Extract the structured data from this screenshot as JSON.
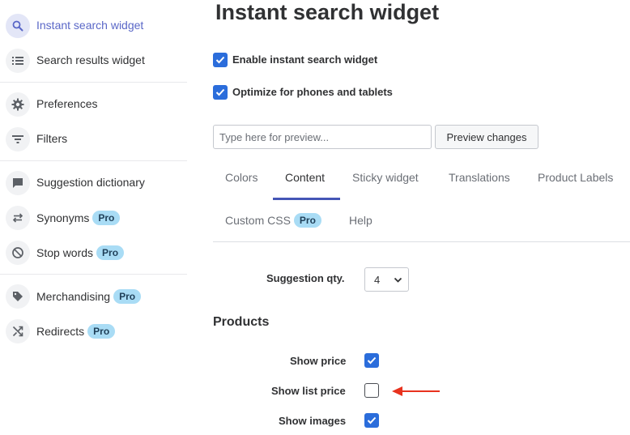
{
  "sidebar": {
    "items": [
      {
        "label": "Instant search widget",
        "icon": "search-icon",
        "active": true
      },
      {
        "label": "Search results widget",
        "icon": "list-icon"
      },
      {
        "label": "Preferences",
        "icon": "gear-icon"
      },
      {
        "label": "Filters",
        "icon": "filter-icon"
      },
      {
        "label": "Suggestion dictionary",
        "icon": "chat-icon"
      },
      {
        "label": "Synonyms",
        "icon": "swap-icon",
        "badge": "Pro"
      },
      {
        "label": "Stop words",
        "icon": "block-icon",
        "badge": "Pro"
      },
      {
        "label": "Merchandising",
        "icon": "tag-icon",
        "badge": "Pro"
      },
      {
        "label": "Redirects",
        "icon": "shuffle-icon",
        "badge": "Pro"
      }
    ]
  },
  "page": {
    "title": "Instant search widget"
  },
  "settings": {
    "enable_label": "Enable instant search widget",
    "enable_checked": true,
    "optimize_label": "Optimize for phones and tablets",
    "optimize_checked": true
  },
  "preview": {
    "placeholder": "Type here for preview...",
    "value": "",
    "button_label": "Preview changes"
  },
  "tabs": [
    {
      "label": "Colors"
    },
    {
      "label": "Content",
      "active": true
    },
    {
      "label": "Sticky widget"
    },
    {
      "label": "Translations"
    },
    {
      "label": "Product Labels"
    },
    {
      "label": "Custom CSS",
      "badge": "Pro"
    },
    {
      "label": "Help"
    }
  ],
  "content": {
    "suggestion_qty_label": "Suggestion qty.",
    "suggestion_qty_value": "4",
    "products_heading": "Products",
    "show_price_label": "Show price",
    "show_price_checked": true,
    "show_list_price_label": "Show list price",
    "show_list_price_checked": false,
    "show_images_label": "Show images",
    "show_images_checked": true
  },
  "colors": {
    "accent": "#2b6ddb",
    "active_nav": "#5a67c7",
    "pro_badge": "#a9dcf5",
    "annotation_arrow": "#e8321e"
  }
}
